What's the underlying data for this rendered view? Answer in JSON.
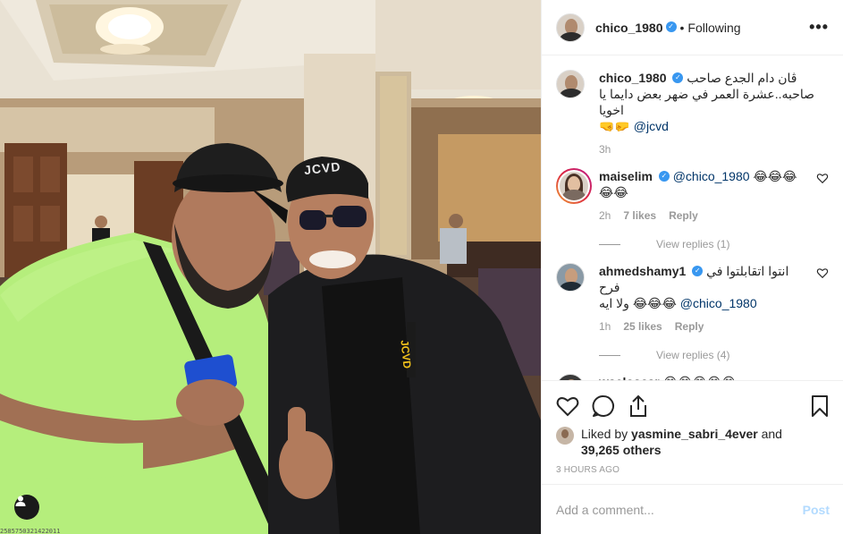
{
  "photo": {
    "cap_left_text": "JCVD",
    "shirt_text": "JCVD",
    "bottom_left_text": "2585750321422011"
  },
  "header": {
    "username": "chico_1980",
    "verified_mark": "✓",
    "separator": "•",
    "follow_status": "Following",
    "more_label": "•••"
  },
  "caption": {
    "username": "chico_1980",
    "text_line1": "ڤان دام الجدع صاحب",
    "text_line2": "صاحبه..عشرة العمر في ضهر بعض دايما يا اخويا",
    "emoji": "🤜🤛",
    "mention": "@jcvd",
    "time": "3h"
  },
  "comments": [
    {
      "username": "maiselim",
      "mention": "@chico_1980",
      "text": "😂😂😂😂😂",
      "time": "2h",
      "likes": "7 likes",
      "reply": "Reply",
      "view_replies": "View replies (1)"
    },
    {
      "username": "ahmedshamy1",
      "text_rtl": "انتوا اتقابلتوا في فرح",
      "text_rtl2": "ولا ايه",
      "emoji": "😂😂😂",
      "mention": "@chico_1980",
      "time": "1h",
      "likes": "25 likes",
      "reply": "Reply",
      "view_replies": "View replies (4)"
    },
    {
      "username": "waeloscar",
      "text": "😂😂😂😂😂"
    }
  ],
  "likes": {
    "liked_by": "Liked by",
    "liker": "yasmine_sabri_4ever",
    "and": "and",
    "others": "39,265 others"
  },
  "timestamp": "3 HOURS AGO",
  "add_comment": {
    "placeholder": "Add a comment...",
    "post_label": "Post"
  },
  "colors": {
    "verified": "#3897f0",
    "post_disabled": "#b3dbff",
    "meta_gray": "#999999",
    "border": "#efefef"
  },
  "icons": {
    "like": "heart-icon",
    "comment": "comment-icon",
    "share": "share-icon",
    "save": "bookmark-icon",
    "tag": "user-tag-icon"
  }
}
